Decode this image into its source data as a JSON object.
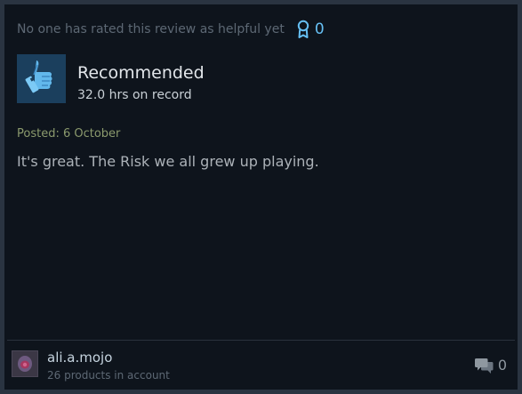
{
  "helpful": {
    "text": "No one has rated this review as helpful yet",
    "award_count": "0",
    "award_icon": "award-ribbon-icon"
  },
  "recommendation": {
    "status": "Recommended",
    "hours": "32.0 hrs on record",
    "icon": "thumbs-up-icon"
  },
  "review": {
    "posted": "Posted: 6 October",
    "body": "It's great. The Risk we all grew up playing."
  },
  "author": {
    "name": "ali.a.mojo",
    "products": "26 products in account"
  },
  "comments": {
    "count": "0",
    "icon": "comment-bubbles-icon"
  },
  "colors": {
    "background": "#0e141c",
    "accent": "#66c0f4",
    "thumb_box": "#1b3f5d",
    "posted": "#8b9a6d"
  }
}
